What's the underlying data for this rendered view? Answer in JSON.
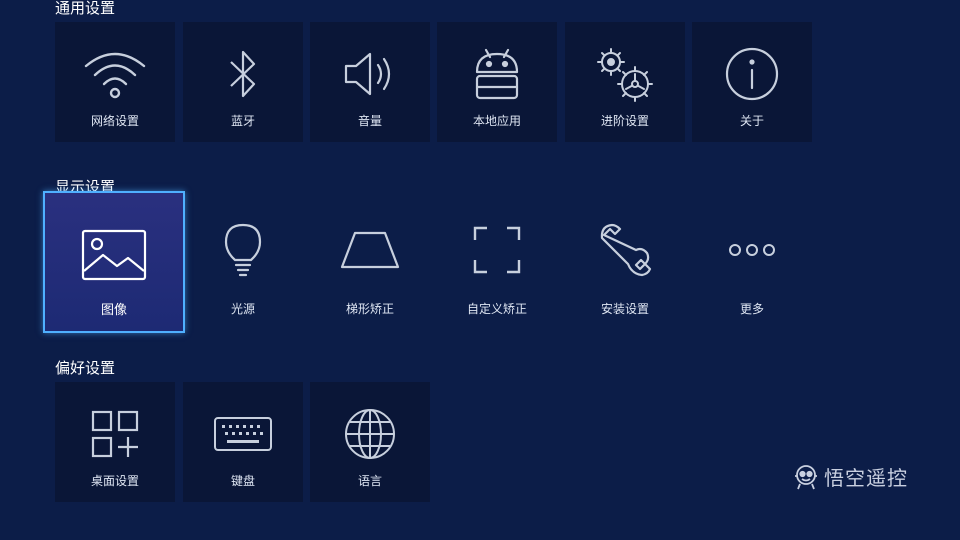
{
  "sections": {
    "general": {
      "title": "通用设置",
      "items": [
        {
          "label": "网络设置",
          "icon": "wifi-icon"
        },
        {
          "label": "蓝牙",
          "icon": "bluetooth-icon"
        },
        {
          "label": "音量",
          "icon": "speaker-icon"
        },
        {
          "label": "本地应用",
          "icon": "android-icon"
        },
        {
          "label": "进阶设置",
          "icon": "gears-icon"
        },
        {
          "label": "关于",
          "icon": "info-icon"
        }
      ]
    },
    "display": {
      "title": "显示设置",
      "selected": "图像",
      "items": [
        {
          "label": "图像",
          "icon": "image-icon"
        },
        {
          "label": "光源",
          "icon": "lightbulb-icon"
        },
        {
          "label": "梯形矫正",
          "icon": "trapezoid-icon"
        },
        {
          "label": "自定义矫正",
          "icon": "frame-corners-icon"
        },
        {
          "label": "安装设置",
          "icon": "wrench-icon"
        },
        {
          "label": "更多",
          "icon": "more-dots-icon"
        }
      ]
    },
    "preferences": {
      "title": "偏好设置",
      "items": [
        {
          "label": "桌面设置",
          "icon": "grid-plus-icon"
        },
        {
          "label": "键盘",
          "icon": "keyboard-icon"
        },
        {
          "label": "语言",
          "icon": "globe-icon"
        }
      ]
    }
  },
  "watermark": {
    "text": "悟空遥控",
    "icon": "robot-icon"
  },
  "colors": {
    "background": "#0c1d48",
    "tile": "#0a1637",
    "selected_border": "#4fb0ff",
    "selected_fill": "#2a307f"
  }
}
